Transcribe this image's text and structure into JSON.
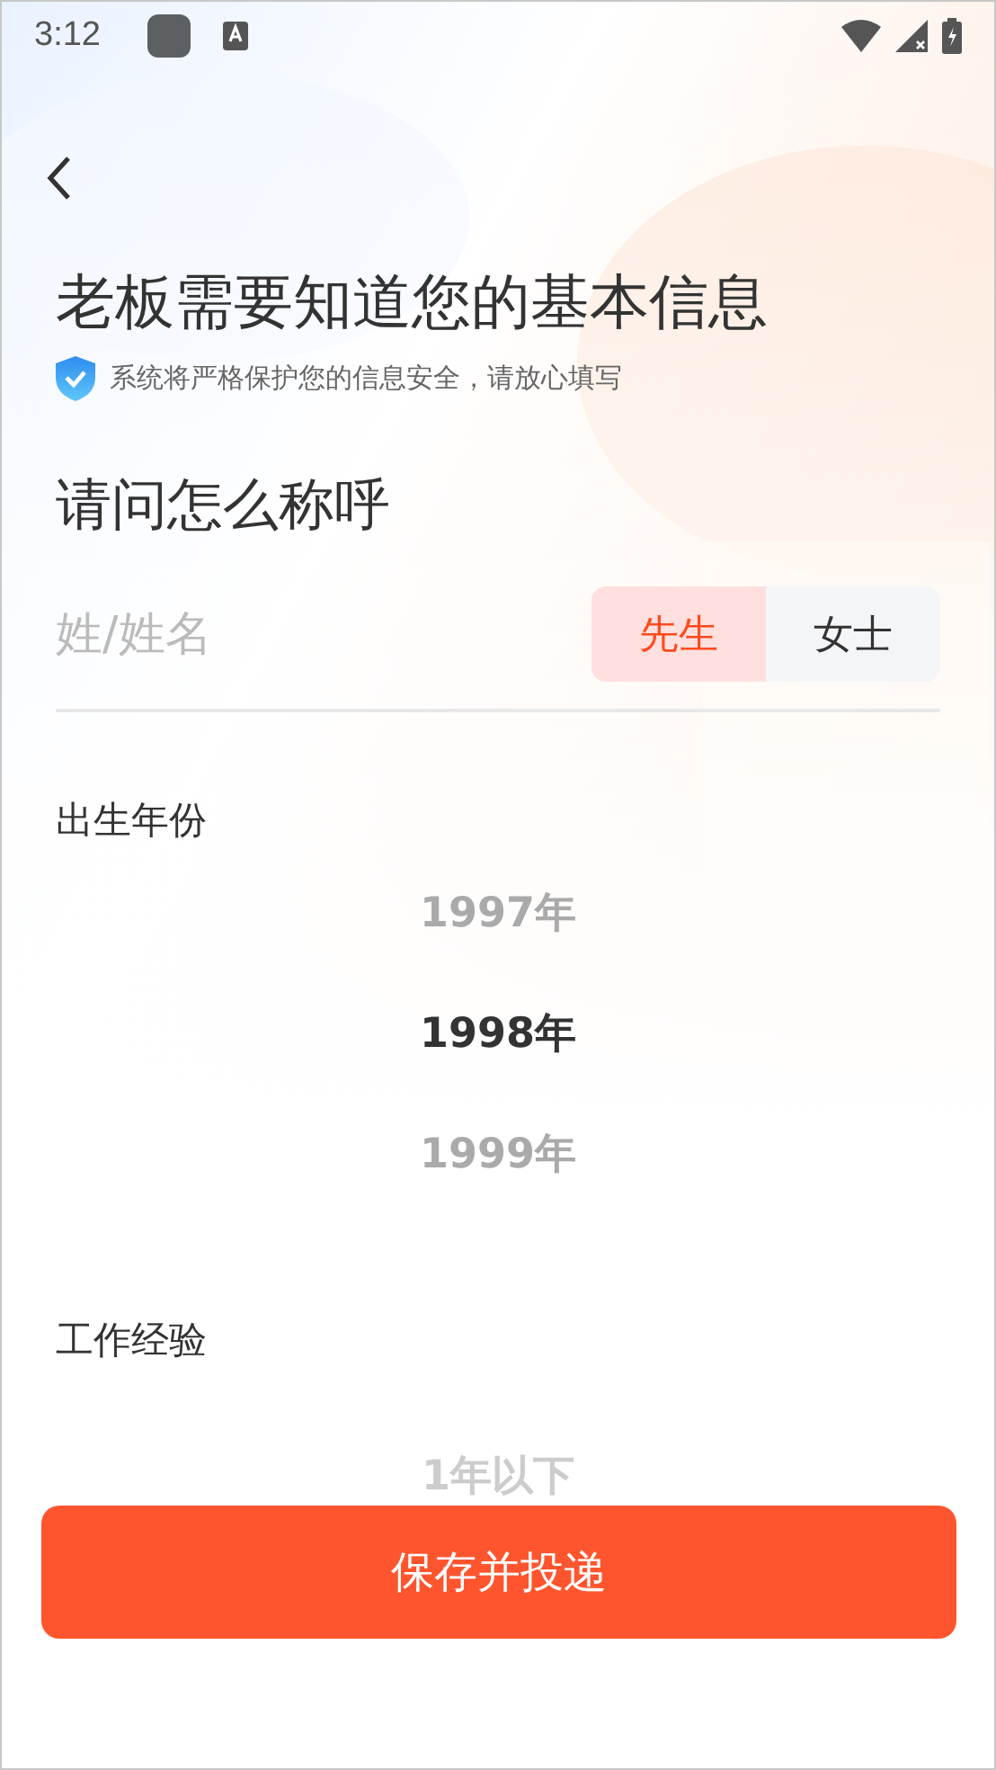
{
  "status_bar": {
    "time": "3:12"
  },
  "title": "老板需要知道您的基本信息",
  "notice": "系统将严格保护您的信息安全，请放心填写",
  "name_section": {
    "heading": "请问怎么称呼",
    "name_field": {
      "placeholder": "姓/姓名"
    },
    "gender_options": [
      {
        "label": "先生",
        "selected": true
      },
      {
        "label": "女士",
        "selected": false
      }
    ]
  },
  "birth_year": {
    "label": "出生年份",
    "options": [
      {
        "label": "1997年",
        "selected": false
      },
      {
        "label": "1998年",
        "selected": true
      },
      {
        "label": "1999年",
        "selected": false
      }
    ]
  },
  "work_experience": {
    "label": "工作经验",
    "options": [
      {
        "label": "1年以下",
        "selected": false
      }
    ]
  },
  "submit_button": "保存并投递"
}
